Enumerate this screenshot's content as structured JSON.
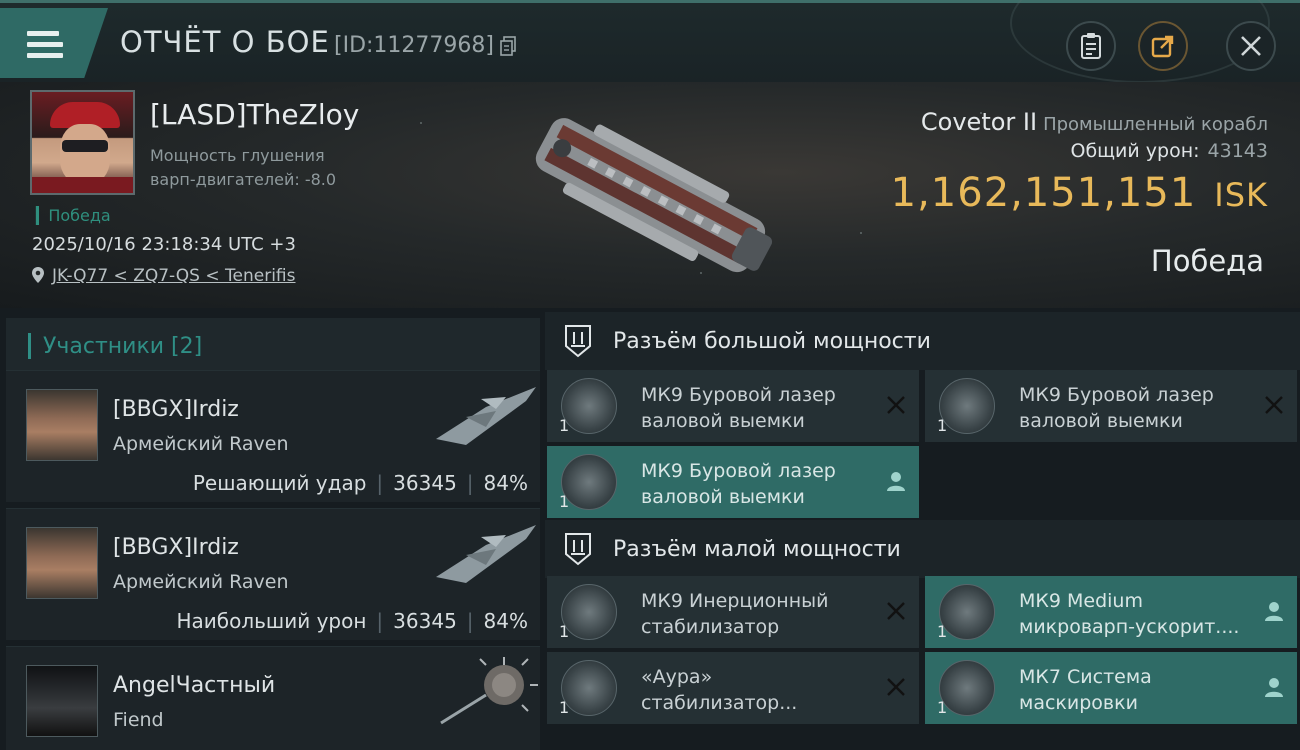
{
  "header": {
    "title": "ОТЧЁТ О БОЕ",
    "report_id": "[ID:11277968]"
  },
  "pilot": {
    "name": "[LASD]TheZloy",
    "stat_line1": "Мощность глушения",
    "stat_line2": "варп-двигателей: -8.0",
    "win_tag": "Победа",
    "datetime": "2025/10/16 23:18:34 UTC +3",
    "location": "JK-Q77 < ZQ7-QS < Tenerifis"
  },
  "target": {
    "ship_name": "Covetor II",
    "ship_class": "Промышленный корабл",
    "damage_label": "Общий урон:",
    "damage_value": "43143",
    "isk_value": "1,162,151,151",
    "isk_unit": "ISK",
    "result": "Победа"
  },
  "participants": {
    "header": "Участники [2]",
    "rows": [
      {
        "name": "[BBGX]Irdiz",
        "ship": "Армейский Raven",
        "role": "Решающий удар",
        "damage": "36345",
        "percent": "84%"
      },
      {
        "name": "[BBGX]Irdiz",
        "ship": "Армейский Raven",
        "role": "Наибольший урон",
        "damage": "36345",
        "percent": "84%"
      },
      {
        "name": "AngelЧастный",
        "ship": "Fiend"
      }
    ]
  },
  "fittings": {
    "high_slot_label": "Разъём большой мощности",
    "low_slot_label": "Разъём малой мощности",
    "high": [
      {
        "line1": "МК9 Буровой лазер",
        "line2": "валовой выемки",
        "qty": "1",
        "status": "destroyed"
      },
      {
        "line1": "МК9 Буровой лазер",
        "line2": "валовой выемки",
        "qty": "1",
        "status": "destroyed"
      },
      {
        "line1": "МК9 Буровой лазер",
        "line2": "валовой выемки",
        "qty": "1",
        "status": "dropped"
      }
    ],
    "low": [
      {
        "line1": "МК9 Инерционный",
        "line2": "стабилизатор",
        "qty": "1",
        "status": "destroyed"
      },
      {
        "line1": "МК9 Medium",
        "line2": "микроварп-ускорит....",
        "qty": "1",
        "status": "dropped"
      },
      {
        "line1": "«Аура»",
        "line2": "стабилизатор...",
        "qty": "1",
        "status": "destroyed"
      },
      {
        "line1": "МК7 Система",
        "line2": "маскировки",
        "qty": "1",
        "status": "dropped"
      }
    ]
  },
  "colors": {
    "accent_teal": "#2f8f86",
    "active_module": "#2f6b66",
    "isk_gold": "#e8b95a"
  }
}
